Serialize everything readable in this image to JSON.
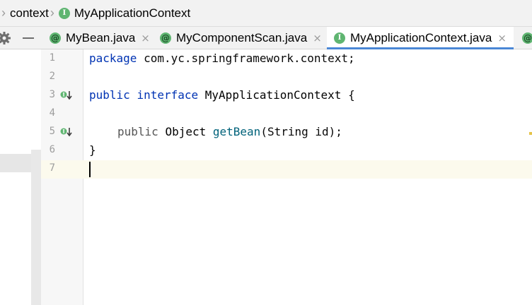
{
  "breadcrumb": {
    "items": [
      {
        "label": "context",
        "icon": "none"
      },
      {
        "label": "MyApplicationContext",
        "icon": "interface-icon"
      }
    ],
    "separator": "›"
  },
  "tabs": [
    {
      "label": "MyBean.java",
      "icon": "annotation-icon",
      "active": false
    },
    {
      "label": "MyComponentScan.java",
      "icon": "annotation-icon",
      "active": false
    },
    {
      "label": "MyApplicationContext.java",
      "icon": "interface-icon",
      "active": true
    }
  ],
  "icons": {
    "interface_letter": "I",
    "annotation_letter": "@",
    "close": "×"
  },
  "lines": {
    "n1": "1",
    "n2": "2",
    "n3": "3",
    "n4": "4",
    "n5": "5",
    "n6": "6",
    "n7": "7"
  },
  "code": {
    "l1_kw": "package",
    "l1_rest": " com.yc.springframework.context;",
    "l3_kw1": "public",
    "l3_kw2": "interface",
    "l3_name": "MyApplicationContext",
    "l3_brace": " {",
    "l5_kw": "public",
    "l5_type": "Object",
    "l5_method": "getBean",
    "l5_params": "(String id);",
    "l6": "}"
  },
  "colors": {
    "keyword": "#0033b3",
    "method": "#00627a",
    "active_tab_underline": "#4a87d6",
    "icon_green": "#5fb571"
  }
}
